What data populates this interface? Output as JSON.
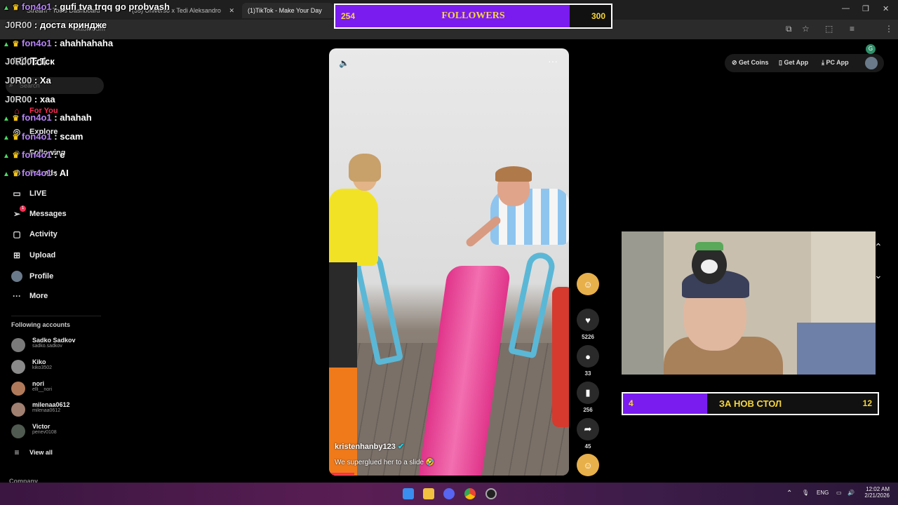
{
  "browser": {
    "tabs": [
      {
        "title": "Stream - Tools Dashboard",
        "active": false
      },
      {
        "title": "(35) Universo x Tedi Aleksandro",
        "active": false
      },
      {
        "title": "(1)TikTok - Make Your Day",
        "active": true
      }
    ],
    "url": "tiktok.com",
    "profile_letter": "G"
  },
  "tiktok": {
    "logo": "TikTok",
    "search_placeholder": "Search",
    "nav": [
      {
        "label": "For You",
        "icon": "home-icon"
      },
      {
        "label": "Explore",
        "icon": "compass-icon"
      },
      {
        "label": "Following",
        "icon": "following-icon"
      },
      {
        "label": "Friends",
        "icon": "friends-icon"
      },
      {
        "label": "LIVE",
        "icon": "live-icon"
      },
      {
        "label": "Messages",
        "icon": "messages-icon",
        "badge": "1"
      },
      {
        "label": "Activity",
        "icon": "activity-icon"
      },
      {
        "label": "Upload",
        "icon": "upload-icon"
      },
      {
        "label": "Profile",
        "icon": "profile-icon"
      },
      {
        "label": "More",
        "icon": "more-icon"
      }
    ],
    "following_title": "Following accounts",
    "accounts": [
      {
        "name": "Sadko Sadkov",
        "user": "sadko.sadkov",
        "color": "#7a7a7a"
      },
      {
        "name": "Kiko",
        "user": "kiko3502",
        "color": "#8a8a8a"
      },
      {
        "name": "nori",
        "user": "elli__nori",
        "color": "#b07a5a"
      },
      {
        "name": "milenaa0612",
        "user": "milenaa0612",
        "color": "#a08070"
      },
      {
        "name": "Victor",
        "user": "penev0108",
        "color": "#505a50"
      }
    ],
    "view_all": "View all",
    "company": "Company",
    "topbar": {
      "coins": "Get Coins",
      "app": "Get App",
      "pc": "PC App"
    },
    "video": {
      "author": "kristenhanby123",
      "caption": "We superglued her to a slide 🤣",
      "likes": "5226",
      "comments": "33",
      "saves": "256",
      "shares": "45"
    }
  },
  "chat": [
    {
      "user": "fon4o1",
      "msg": "gufi tva trqq go probvash",
      "style": "u1"
    },
    {
      "user": "J0R00",
      "msg": "доста криндже",
      "style": "u2"
    },
    {
      "user": "fon4o1",
      "msg": "ahahhahaha",
      "style": "u1"
    },
    {
      "user": "J0R00",
      "msg": "Тск",
      "style": "u2"
    },
    {
      "user": "J0R00",
      "msg": "Xa",
      "style": "u2"
    },
    {
      "user": "J0R00",
      "msg": "xaa",
      "style": "u2"
    },
    {
      "user": "fon4o1",
      "msg": "ahahah",
      "style": "u1"
    },
    {
      "user": "fon4o1",
      "msg": "scam",
      "style": "u1"
    },
    {
      "user": "fon4o1",
      "msg": "e",
      "style": "u1"
    },
    {
      "user": "fon4o1",
      "msg": "AI",
      "style": "u1"
    }
  ],
  "followers_goal": {
    "current": "254",
    "label": "FOLLOWERS",
    "target": "300",
    "progress": 0.85
  },
  "table_goal": {
    "current": "4",
    "label": "ЗА НОВ СТОЛ",
    "target": "12",
    "progress": 0.33
  },
  "taskbar": {
    "lang": "ENG",
    "time": "12:02 AM",
    "date": "2/21/2026"
  }
}
